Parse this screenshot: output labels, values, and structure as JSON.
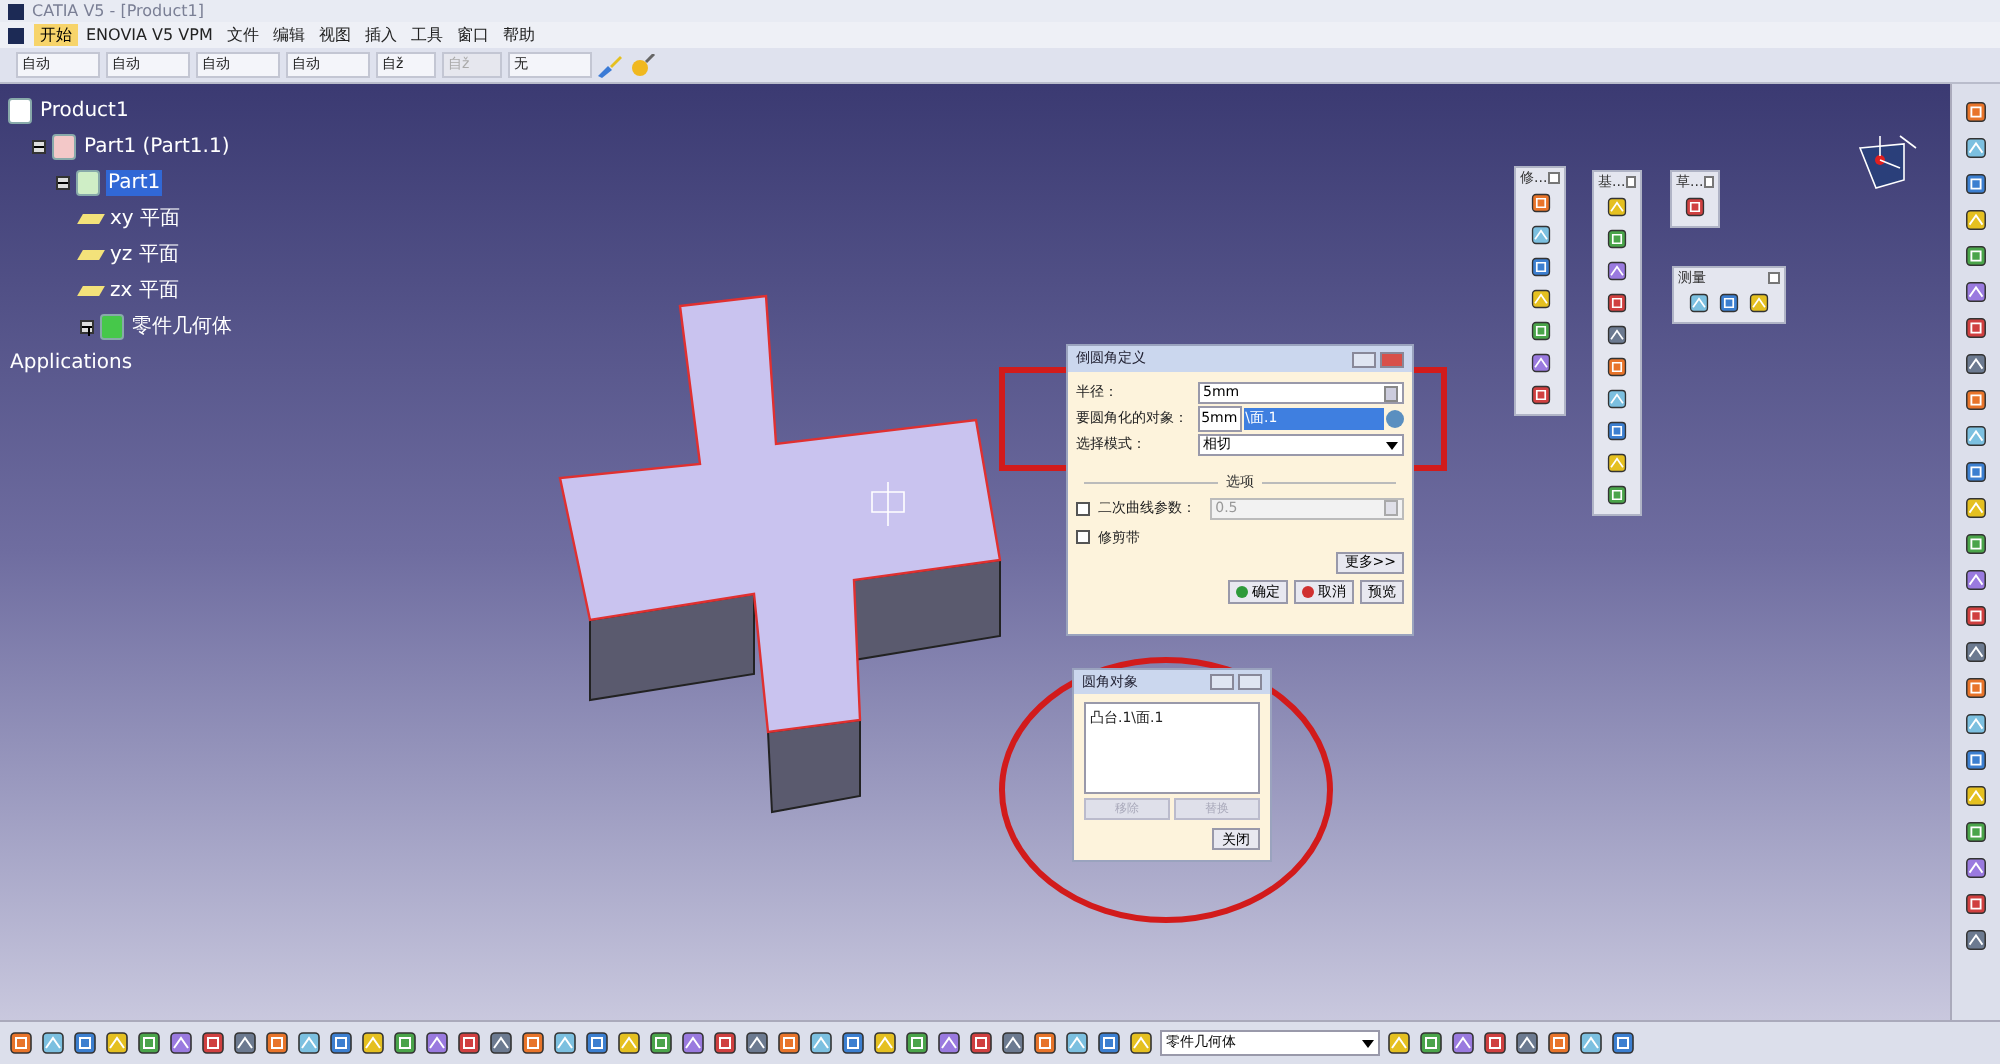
{
  "window": {
    "title": "CATIA V5 - [Product1]"
  },
  "menu": [
    {
      "label": "开始",
      "selected": true
    },
    {
      "label": "ENOVIA V5 VPM",
      "selected": false
    },
    {
      "label": "文件",
      "selected": false
    },
    {
      "label": "编辑",
      "selected": false
    },
    {
      "label": "视图",
      "selected": false
    },
    {
      "label": "插入",
      "selected": false
    },
    {
      "label": "工具",
      "selected": false
    },
    {
      "label": "窗口",
      "selected": false
    },
    {
      "label": "帮助",
      "selected": false
    }
  ],
  "toolbar_combos": [
    {
      "value": "自动",
      "disabled": false
    },
    {
      "value": "自动",
      "disabled": false
    },
    {
      "value": "自动",
      "disabled": false
    },
    {
      "value": "自动",
      "disabled": false
    },
    {
      "value": "自ž",
      "disabled": false
    },
    {
      "value": "自ž",
      "disabled": true
    },
    {
      "value": "无",
      "disabled": false
    }
  ],
  "tree": [
    {
      "label": "Product1",
      "kind": "product",
      "selected": false,
      "children": [
        {
          "label": "Part1 (Part1.1)",
          "kind": "part",
          "selected": false,
          "expanded": true,
          "children": [
            {
              "label": "Part1",
              "kind": "partbody",
              "selected": true,
              "expanded": true,
              "children": [
                {
                  "label": "xy 平面",
                  "kind": "plane",
                  "selected": false
                },
                {
                  "label": "yz 平面",
                  "kind": "plane",
                  "selected": false
                },
                {
                  "label": "zx 平面",
                  "kind": "plane",
                  "selected": false
                },
                {
                  "label": "零件几何体",
                  "kind": "body",
                  "selected": false,
                  "expanded": false
                }
              ]
            }
          ]
        }
      ]
    },
    {
      "label": "Applications",
      "kind": "text",
      "selected": false
    }
  ],
  "floating_toolbars": [
    {
      "title": "修..."
    },
    {
      "title": "基..."
    },
    {
      "title": "草..."
    },
    {
      "title": "测量"
    }
  ],
  "fillet_dialog": {
    "title": "倒圆角定义",
    "radius_label": "半径：",
    "radius_value": "5mm",
    "object_label": "要圆角化的对象：",
    "object_prefix": "5mm",
    "object_value": "\\面.1",
    "mode_label": "选择模式：",
    "mode_value": "相切",
    "options_label": "选项",
    "conic_label": "二次曲线参数：",
    "conic_checked": false,
    "conic_value": "0.5",
    "trim_label": "修剪带",
    "trim_checked": false,
    "more_button": "更多>>",
    "ok_button": "确定",
    "cancel_button": "取消",
    "preview_button": "预览"
  },
  "objects_dialog": {
    "title": "圆角对象",
    "items": [
      "凸台.1\\面.1"
    ],
    "remove_button": "移除",
    "replace_button": "替换",
    "buttons_disabled": true,
    "close_button": "关闭"
  },
  "status_bar": {
    "body_combo": "零件几何体"
  }
}
